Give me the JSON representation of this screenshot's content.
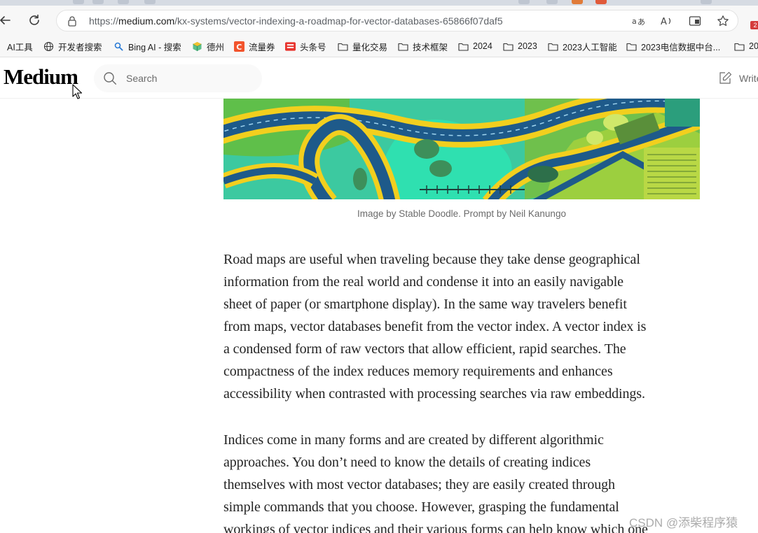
{
  "browser": {
    "url_prefix": "https://",
    "url_host": "medium.com",
    "url_path": "/kx-systems/vector-indexing-a-roadmap-for-vector-databases-65866f07daf5",
    "tab_badge": "2"
  },
  "bookmarks": [
    {
      "label": "AI工具",
      "icon": "folder-icon"
    },
    {
      "label": "开发者搜索",
      "icon": "globe-icon"
    },
    {
      "label": "Bing AI - 搜索",
      "icon": "bing-search-icon"
    },
    {
      "label": "德州",
      "icon": "box-icon"
    },
    {
      "label": "流量券",
      "icon": "c-logo-icon"
    },
    {
      "label": "头条号",
      "icon": "toutiao-icon"
    },
    {
      "label": "量化交易",
      "icon": "folder-icon"
    },
    {
      "label": "技术框架",
      "icon": "folder-icon"
    },
    {
      "label": "2024",
      "icon": "folder-icon"
    },
    {
      "label": "2023",
      "icon": "folder-icon"
    },
    {
      "label": "2023人工智能",
      "icon": "folder-icon"
    },
    {
      "label": "2023电信数据中台...",
      "icon": "folder-icon"
    },
    {
      "label": "20",
      "icon": "folder-icon"
    }
  ],
  "header": {
    "logo": "Medium",
    "search_placeholder": "Search",
    "write_label": "Write"
  },
  "article": {
    "caption": "Image by Stable Doodle. Prompt by Neil Kanungo",
    "paragraph1_lines": [
      "Road maps are useful when traveling because they take dense geographical",
      "information from the real world and condense it into an easily navigable",
      "sheet of paper (or smartphone display). In the same way travelers benefit",
      "from maps, vector databases benefit from the vector index. A vector index is",
      "a condensed form of raw vectors that allow efficient, rapid searches. The",
      "compactness of the index reduces memory requirements and enhances",
      "accessibility when contrasted with processing searches via raw embeddings."
    ],
    "paragraph2_lines": [
      "Indices come in many forms and are created by different algorithmic",
      "approaches. You don’t need to know the details of creating indices",
      "themselves with most vector databases; they are easily created through",
      "simple commands that you choose. However, grasping the fundamental",
      "workings of vector indices and their various forms can help know which one"
    ]
  },
  "watermark": "CSDN @添柴程序猿",
  "colors": {
    "hero_teal": "#38d3a8",
    "hero_yellow": "#f2cf1e",
    "hero_blue": "#1e5a8a",
    "hero_green": "#7fbf3f"
  }
}
